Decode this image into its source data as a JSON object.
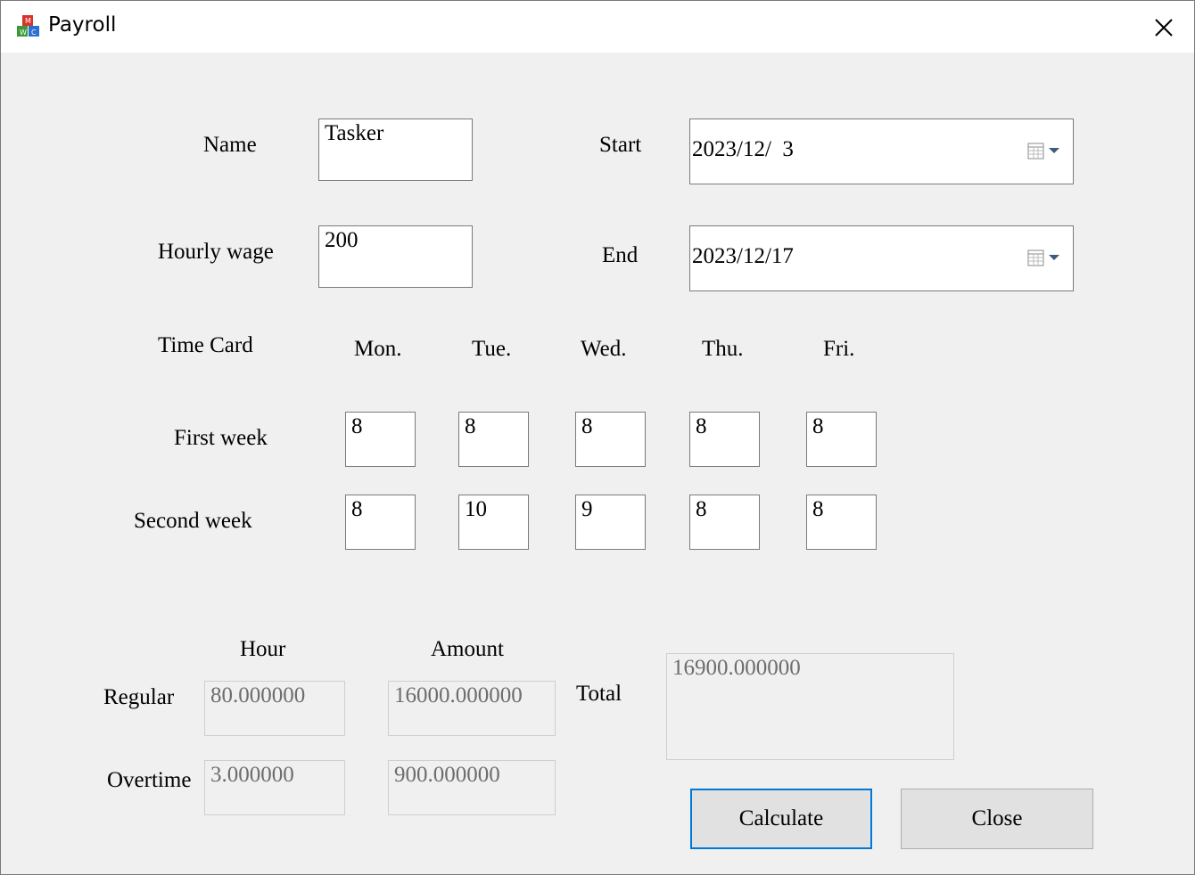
{
  "window": {
    "title": "Payroll",
    "close_icon": "close-icon",
    "app_icon": "app-blocks-icon"
  },
  "form": {
    "name_label": "Name",
    "name_value": "Tasker",
    "wage_label": "Hourly wage",
    "wage_value": "200",
    "start_label": "Start",
    "start_value": "2023/12/  3",
    "end_label": "End",
    "end_value": "2023/12/17"
  },
  "timecard": {
    "title": "Time Card",
    "days": [
      "Mon.",
      "Tue.",
      "Wed.",
      "Thu.",
      "Fri."
    ],
    "weeks": [
      {
        "label": "First week",
        "hours": [
          "8",
          "8",
          "8",
          "8",
          "8"
        ]
      },
      {
        "label": "Second week",
        "hours": [
          "8",
          "10",
          "9",
          "8",
          "8"
        ]
      }
    ]
  },
  "results": {
    "hour_header": "Hour",
    "amount_header": "Amount",
    "regular_label": "Regular",
    "regular_hours": "80.000000",
    "regular_amount": "16000.000000",
    "overtime_label": "Overtime",
    "overtime_hours": "3.000000",
    "overtime_amount": "900.000000",
    "total_label": "Total",
    "total_value": "16900.000000"
  },
  "buttons": {
    "calculate": "Calculate",
    "close": "Close"
  },
  "colors": {
    "window_bg": "#f0f0f0",
    "focus_border": "#0078d7",
    "readonly_text": "#6d6d6d"
  }
}
